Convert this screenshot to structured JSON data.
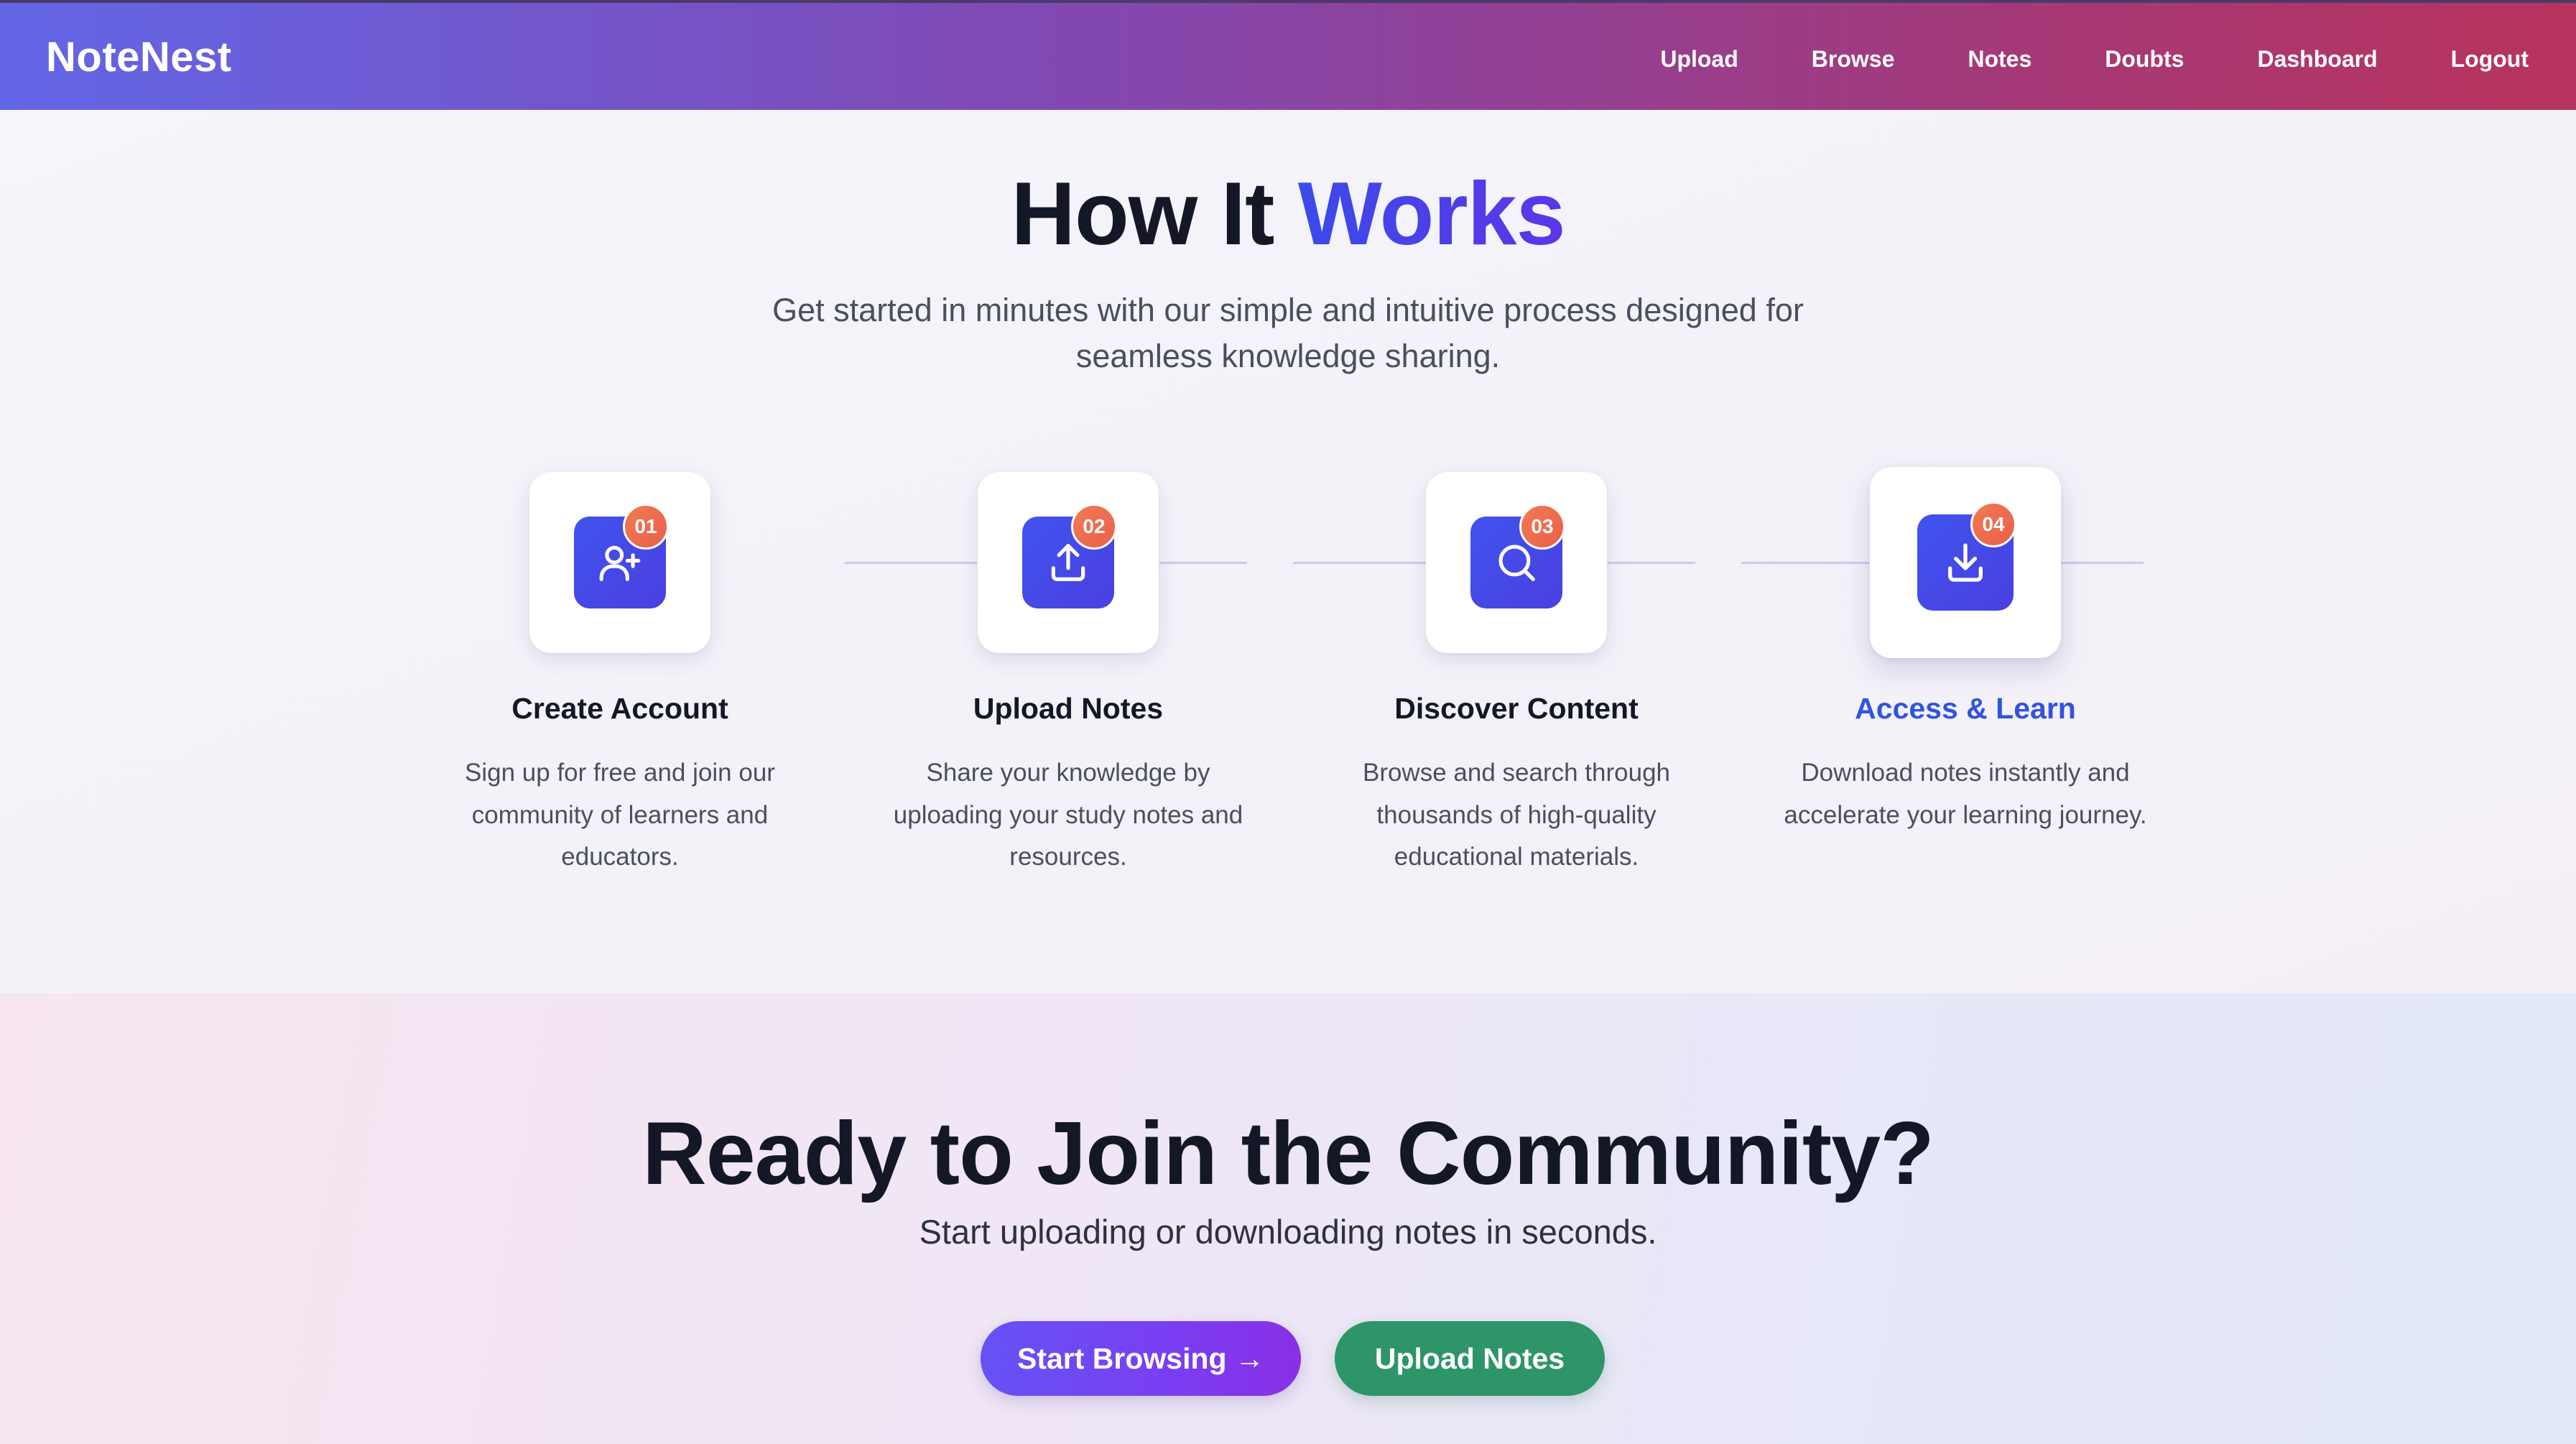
{
  "navbar": {
    "brand": "NoteNest",
    "links": [
      "Upload",
      "Browse",
      "Notes",
      "Doubts",
      "Dashboard",
      "Logout"
    ]
  },
  "how_it_works": {
    "title_main": "How It ",
    "title_accent": "Works",
    "subtitle": "Get started in minutes with our simple and intuitive process designed for seamless knowledge sharing.",
    "steps": [
      {
        "badge": "01",
        "icon": "user-plus-icon",
        "title": "Create Account",
        "description": "Sign up for free and join our community of learners and educators."
      },
      {
        "badge": "02",
        "icon": "upload-icon",
        "title": "Upload Notes",
        "description": "Share your knowledge by uploading your study notes and resources."
      },
      {
        "badge": "03",
        "icon": "search-icon",
        "title": "Discover Content",
        "description": "Browse and search through thousands of high-quality educational materials."
      },
      {
        "badge": "04",
        "icon": "download-icon",
        "title": "Access & Learn",
        "description": "Download notes instantly and accelerate your learning journey."
      }
    ]
  },
  "cta": {
    "title": "Ready to Join the Community?",
    "subtitle": "Start uploading or downloading notes in seconds.",
    "browse_label": "Start Browsing →",
    "upload_label": "Upload Notes"
  },
  "colors": {
    "accent": "#3b4ae8",
    "badge": "#ef6f4e",
    "upload_button": "#2e9569"
  }
}
